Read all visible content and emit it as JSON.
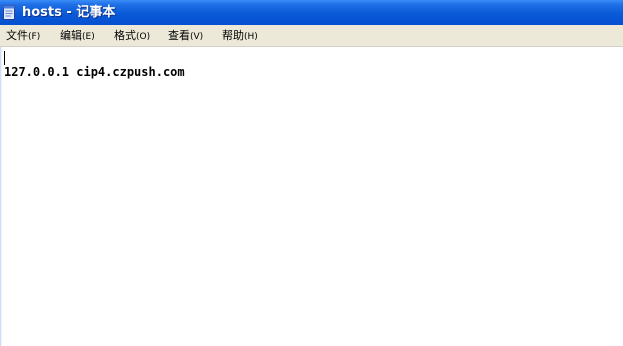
{
  "window": {
    "title": "hosts - 记事本"
  },
  "menu": {
    "file": {
      "label": "文件",
      "accel": "(F)"
    },
    "edit": {
      "label": "编辑",
      "accel": "(E)"
    },
    "format": {
      "label": "格式",
      "accel": "(O)"
    },
    "view": {
      "label": "查看",
      "accel": "(V)"
    },
    "help": {
      "label": "帮助",
      "accel": "(H)"
    }
  },
  "document": {
    "line_1": "",
    "line_2": "127.0.0.1 cip4.czpush.com"
  },
  "icons": {
    "app": "notepad-icon"
  }
}
